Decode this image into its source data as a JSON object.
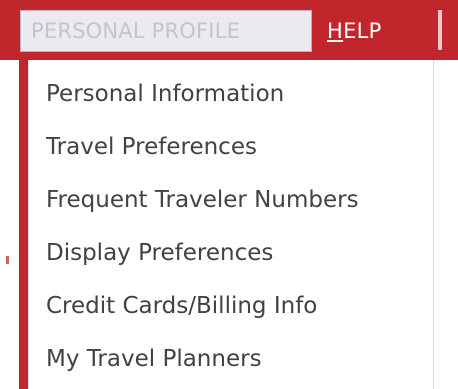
{
  "navbar": {
    "active_menu_label": "PERSONAL PROFILE",
    "help": {
      "mnemonic": "H",
      "rest": "ELP"
    }
  },
  "dropdown": {
    "items": [
      {
        "label": "Personal Information"
      },
      {
        "label": "Travel Preferences"
      },
      {
        "label": "Frequent Traveler Numbers"
      },
      {
        "label": "Display Preferences"
      },
      {
        "label": "Credit Cards/Billing Info"
      },
      {
        "label": "My Travel Planners"
      }
    ]
  },
  "colors": {
    "brand_red": "#c0262c",
    "menu_text": "#424242",
    "active_menu_bg": "#ece9ef"
  }
}
